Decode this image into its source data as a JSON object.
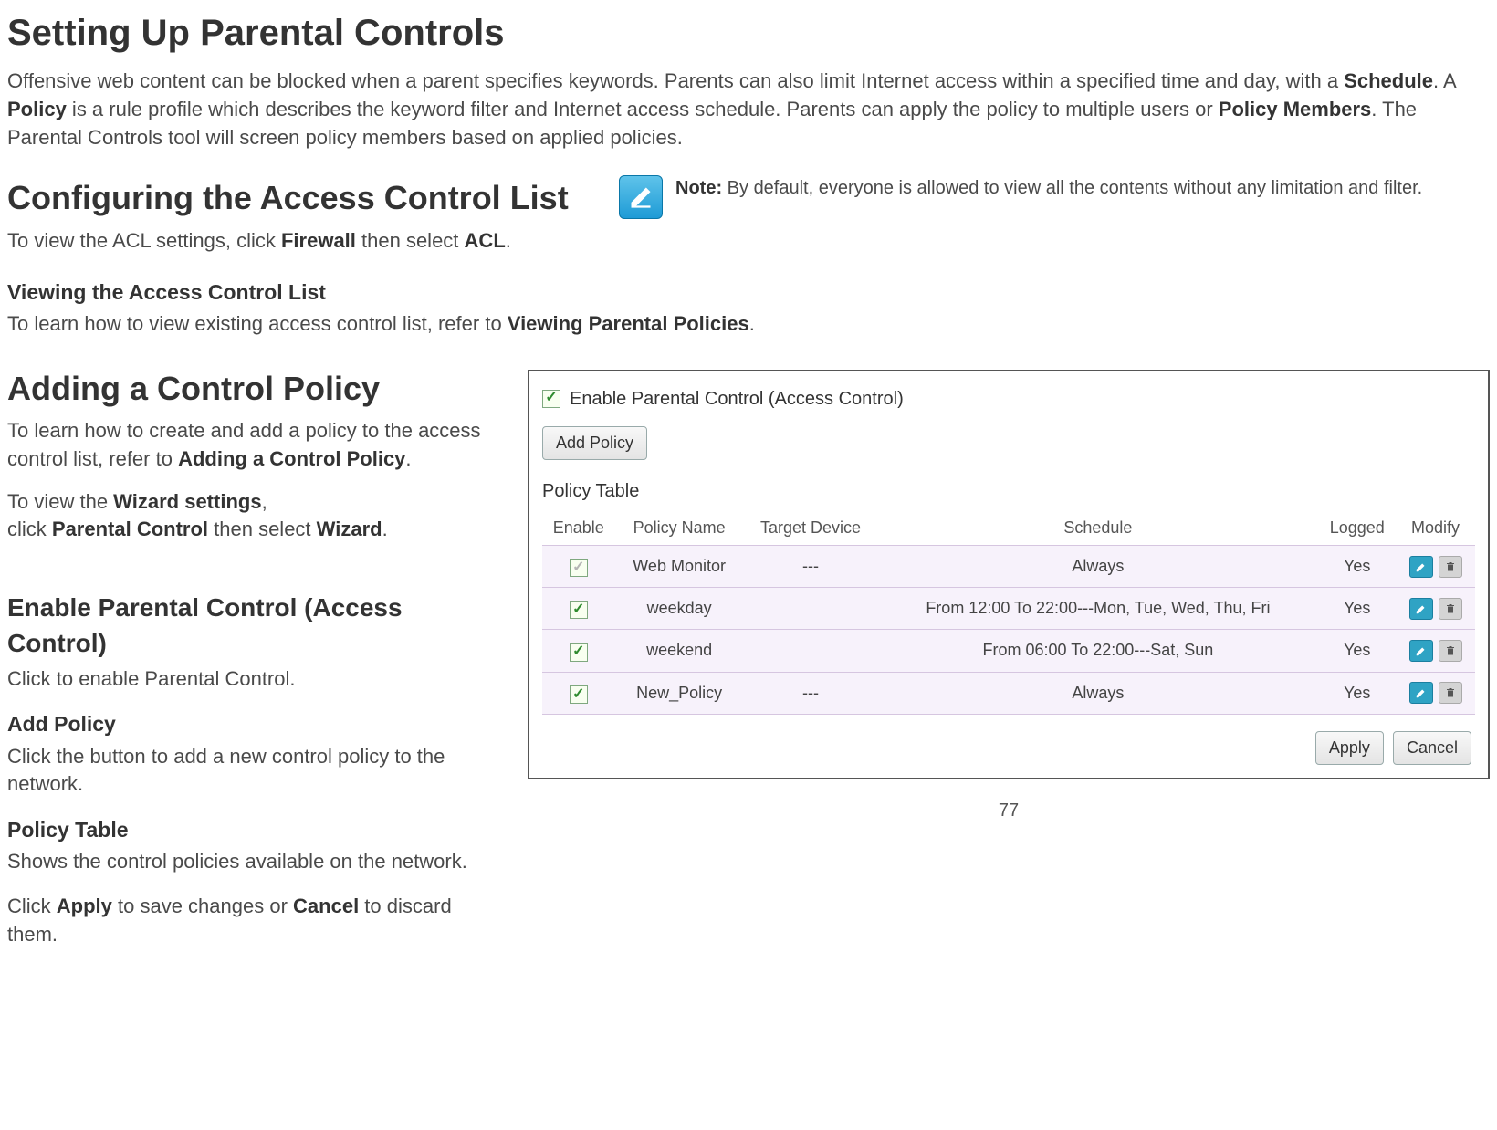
{
  "title": "Setting Up Parental Controls",
  "intro_parts": {
    "p1": "Offensive web content can be blocked when a parent specifies keywords. Parents can also limit Internet access within a specified time and day, with a ",
    "b1": "Schedule",
    "p2": ". A ",
    "b2": "Policy",
    "p3": " is a rule profile which describes the keyword filter and Internet access schedule. Parents can apply the policy to multiple users or ",
    "b3": "Policy Members",
    "p4": ". The Parental Controls tool will screen policy members based on applied policies."
  },
  "acl": {
    "heading": "Configuring the Access Control List",
    "text1": "To view the ACL settings, click ",
    "b1": "Firewall",
    "text2": " then select ",
    "b2": "ACL",
    "text3": "."
  },
  "note": {
    "label": "Note:",
    "body": " By default, everyone is allowed to view all the contents without any limitation and filter."
  },
  "view_acl": {
    "heading": "Viewing the Access Control List",
    "text1": "To learn how to view existing access control list, refer to ",
    "b1": "Viewing Parental Policies",
    "text2": "."
  },
  "add_policy": {
    "heading": "Adding a Control Policy",
    "text1": "To learn how to create and add a policy to the access control list, refer to ",
    "b1": "Adding a Control Policy",
    "text2": ".",
    "wiz1": "To view the ",
    "wizb1": "Wizard settings",
    "wiz2": ",",
    "wiz_br": "click ",
    "wizb2": "Parental Control",
    "wiz3": " then select ",
    "wizb3": "Wizard",
    "wiz4": "."
  },
  "enable": {
    "heading": "Enable Parental Control (Access Control)",
    "text": "Click to enable Parental Control."
  },
  "addp": {
    "heading": "Add Policy",
    "text": "Click the button to add a new control policy to the network."
  },
  "ptable": {
    "heading": "Policy Table",
    "text": "Shows the control policies available on the network."
  },
  "applyline": {
    "p1": "Click ",
    "b1": "Apply",
    "p2": " to save changes or ",
    "b2": "Cancel",
    "p3": " to discard them."
  },
  "panel": {
    "checkbox_label": "Enable Parental Control (Access Control)",
    "add_policy_btn": "Add Policy",
    "table_label": "Policy Table",
    "cols": {
      "c1": "Enable",
      "c2": "Policy Name",
      "c3": "Target Device",
      "c4": "Schedule",
      "c5": "Logged",
      "c6": "Modify"
    },
    "rows": [
      {
        "enabled": "gray",
        "name": "Web Monitor",
        "device": "---",
        "schedule": "Always",
        "logged": "Yes"
      },
      {
        "enabled": "green",
        "name": "weekday",
        "device": "",
        "schedule": "From 12:00 To 22:00---Mon, Tue, Wed, Thu, Fri",
        "logged": "Yes"
      },
      {
        "enabled": "green",
        "name": "weekend",
        "device": "",
        "schedule": "From 06:00 To 22:00---Sat, Sun",
        "logged": "Yes"
      },
      {
        "enabled": "green",
        "name": "New_Policy",
        "device": "---",
        "schedule": "Always",
        "logged": "Yes"
      }
    ],
    "apply_btn": "Apply",
    "cancel_btn": "Cancel"
  },
  "page_number": "77"
}
